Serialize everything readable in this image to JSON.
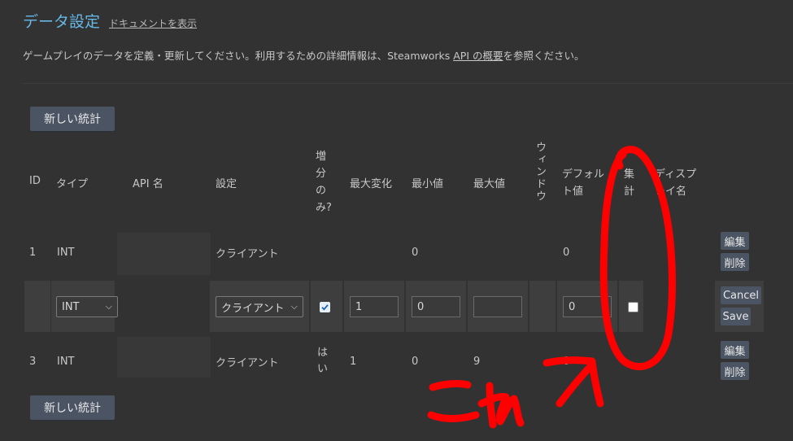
{
  "header": {
    "title": "データ設定",
    "doc_link": "ドキュメントを表示"
  },
  "description": {
    "before": "ゲームプレイのデータを定義・更新してください。利用するための詳細情報は、Steamworks ",
    "link": "API の概要",
    "after": "を参照ください。"
  },
  "buttons": {
    "new_stat": "新しい統計"
  },
  "columns": {
    "id": "ID",
    "type": "タイプ",
    "api_name": "API 名",
    "setting": "設定",
    "increment_only": "増分のみ?",
    "max_change": "最大変化",
    "min_value": "最小値",
    "max_value": "最大値",
    "window": "ウィンドウ",
    "default_value_1": "デフォル",
    "default_value_2": "ト値",
    "aggregate_1": "集",
    "aggregate_2": "計",
    "display_name_1": "ディスプ",
    "display_name_2": "レイ名"
  },
  "rows": [
    {
      "id": "1",
      "type": "INT",
      "setting": "クライアント",
      "min": "0",
      "default": "0",
      "actions": [
        "編集",
        "削除"
      ]
    },
    {
      "editing": true,
      "type_select": "INT",
      "setting_select": "クライアント",
      "increment_only_checked": true,
      "max_change": "1",
      "min": "0",
      "max": "",
      "default": "0",
      "aggregate_checked": false,
      "actions": [
        "Cancel",
        "Save"
      ]
    },
    {
      "id": "3",
      "type": "INT",
      "setting": "クライアント",
      "increment_only_1": "は",
      "increment_only_2": "い",
      "max_change": "1",
      "min": "0",
      "max": "9",
      "default": "0",
      "actions": [
        "編集",
        "削除"
      ]
    }
  ],
  "annotation": {
    "text": "これ",
    "color": "#ff0000"
  },
  "colors": {
    "background": "#323232",
    "title": "#67b8e6",
    "button": "#4b5463"
  }
}
